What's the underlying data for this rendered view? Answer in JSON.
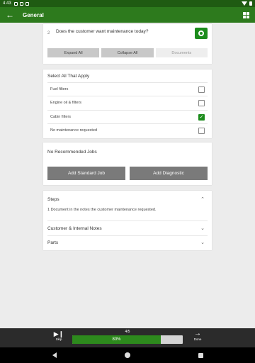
{
  "statusbar": {
    "time": "4:43"
  },
  "appbar": {
    "back_icon": "arrow-left-icon",
    "title": "General",
    "menu_icon": "grid-icon"
  },
  "question": {
    "number": "2",
    "text": "Does the customer want maintenance today?",
    "camera_icon": "camera-icon",
    "buttons": {
      "expand": "Expand All",
      "collapse": "Collapse All",
      "documents": "Documents"
    }
  },
  "select_all": {
    "heading": "Select All That Apply",
    "options": [
      {
        "label": "Fuel filters",
        "checked": false
      },
      {
        "label": "Engine oil & filters",
        "checked": false
      },
      {
        "label": "Cabin filters",
        "checked": true
      },
      {
        "label": "No maintenance requested",
        "checked": false
      }
    ]
  },
  "recommended": {
    "text": "No Recommended Jobs",
    "add_standard": "Add Standard Job",
    "add_diagnostic": "Add Diagnostic"
  },
  "sections": {
    "steps": {
      "label": "Steps",
      "item": "1  Document in the notes the customer maintenance requested."
    },
    "notes": {
      "label": "Customer & Internal Notes"
    },
    "parts": {
      "label": "Parts"
    }
  },
  "footer": {
    "skip": "Skip",
    "done": "Done",
    "page": "4/5",
    "progress": 80,
    "progress_label": "80%",
    "accent": "#2d8a1d"
  }
}
